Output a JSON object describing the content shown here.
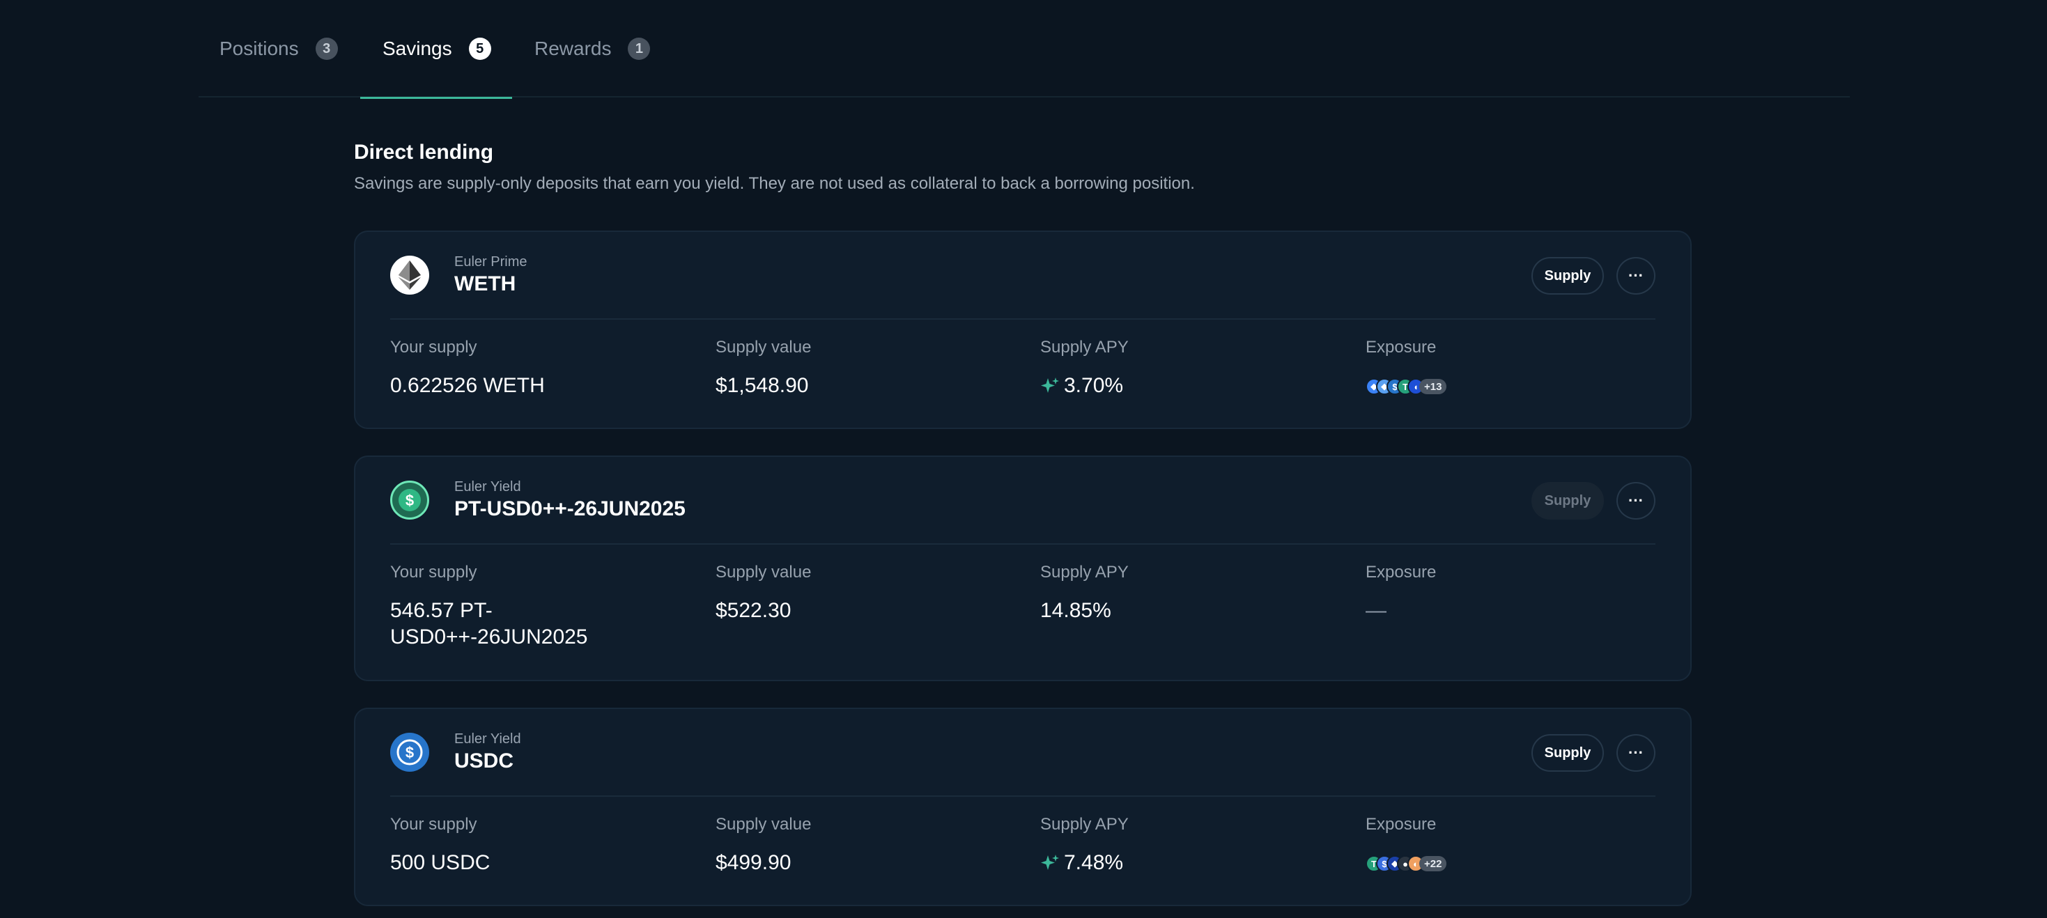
{
  "tabs": [
    {
      "label": "Positions",
      "count": "3"
    },
    {
      "label": "Savings",
      "count": "5"
    },
    {
      "label": "Rewards",
      "count": "1"
    }
  ],
  "active_tab": "Savings",
  "section": {
    "title": "Direct lending",
    "description": "Savings are supply-only deposits that earn you yield. They are not used as collateral to back a borrowing position."
  },
  "metric_labels": {
    "your_supply": "Your supply",
    "supply_value": "Supply value",
    "supply_apy": "Supply APY",
    "exposure": "Exposure"
  },
  "cards": [
    {
      "vault": "Euler Prime",
      "asset": "WETH",
      "supply_button": "Supply",
      "supply_enabled": true,
      "more_button": "···",
      "your_supply": "0.622526 WETH",
      "supply_value": "$1,548.90",
      "supply_apy": "3.70%",
      "apy_rewards_icon": "sparkle-icon",
      "exposure_more": "+13"
    },
    {
      "vault": "Euler Yield",
      "asset": "PT-USD0++-26JUN2025",
      "supply_button": "Supply",
      "supply_enabled": false,
      "more_button": "···",
      "your_supply": "546.57 PT-USD0++-26JUN2025",
      "supply_value": "$522.30",
      "supply_apy": "14.85%",
      "exposure_value": "—"
    },
    {
      "vault": "Euler Yield",
      "asset": "USDC",
      "supply_button": "Supply",
      "supply_enabled": true,
      "more_button": "···",
      "your_supply": "500 USDC",
      "supply_value": "$499.90",
      "supply_apy": "7.48%",
      "apy_rewards_icon": "sparkle-icon",
      "exposure_more": "+22"
    }
  ],
  "colors": {
    "background": "#0b1520",
    "card": "#0f1d2c",
    "accent": "#3cb89a"
  }
}
